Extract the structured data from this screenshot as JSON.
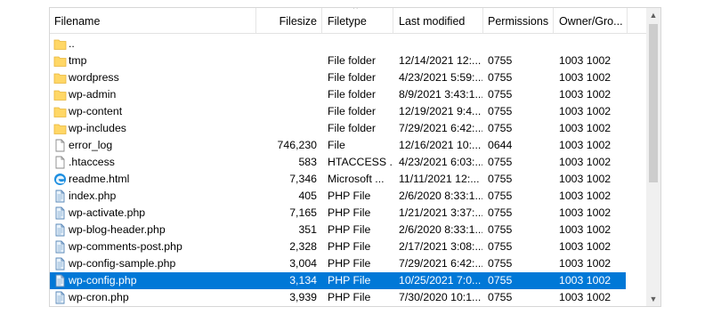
{
  "columns": {
    "filename": "Filename",
    "filesize": "Filesize",
    "filetype": "Filetype",
    "last_modified": "Last modified",
    "permissions": "Permissions",
    "owner": "Owner/Gro..."
  },
  "files": [
    {
      "name": "..",
      "size": "",
      "type": "",
      "modified": "",
      "perm": "",
      "owner": "",
      "icon": "folder-icon"
    },
    {
      "name": "tmp",
      "size": "",
      "type": "File folder",
      "modified": "12/14/2021 12:...",
      "perm": "0755",
      "owner": "1003 1002",
      "icon": "folder-icon"
    },
    {
      "name": "wordpress",
      "size": "",
      "type": "File folder",
      "modified": "4/23/2021 5:59:...",
      "perm": "0755",
      "owner": "1003 1002",
      "icon": "folder-icon"
    },
    {
      "name": "wp-admin",
      "size": "",
      "type": "File folder",
      "modified": "8/9/2021 3:43:1...",
      "perm": "0755",
      "owner": "1003 1002",
      "icon": "folder-icon"
    },
    {
      "name": "wp-content",
      "size": "",
      "type": "File folder",
      "modified": "12/19/2021 9:4...",
      "perm": "0755",
      "owner": "1003 1002",
      "icon": "folder-icon"
    },
    {
      "name": "wp-includes",
      "size": "",
      "type": "File folder",
      "modified": "7/29/2021 6:42:...",
      "perm": "0755",
      "owner": "1003 1002",
      "icon": "folder-icon"
    },
    {
      "name": "error_log",
      "size": "746,230",
      "type": "File",
      "modified": "12/16/2021 10:...",
      "perm": "0644",
      "owner": "1003 1002",
      "icon": "file-icon"
    },
    {
      "name": ".htaccess",
      "size": "583",
      "type": "HTACCESS ...",
      "modified": "4/23/2021 6:03:...",
      "perm": "0755",
      "owner": "1003 1002",
      "icon": "file-icon"
    },
    {
      "name": "readme.html",
      "size": "7,346",
      "type": "Microsoft ...",
      "modified": "11/11/2021 12:...",
      "perm": "0755",
      "owner": "1003 1002",
      "icon": "edge-icon"
    },
    {
      "name": "index.php",
      "size": "405",
      "type": "PHP File",
      "modified": "2/6/2020 8:33:1...",
      "perm": "0755",
      "owner": "1003 1002",
      "icon": "php-file-icon"
    },
    {
      "name": "wp-activate.php",
      "size": "7,165",
      "type": "PHP File",
      "modified": "1/21/2021 3:37:...",
      "perm": "0755",
      "owner": "1003 1002",
      "icon": "php-file-icon"
    },
    {
      "name": "wp-blog-header.php",
      "size": "351",
      "type": "PHP File",
      "modified": "2/6/2020 8:33:1...",
      "perm": "0755",
      "owner": "1003 1002",
      "icon": "php-file-icon"
    },
    {
      "name": "wp-comments-post.php",
      "size": "2,328",
      "type": "PHP File",
      "modified": "2/17/2021 3:08:...",
      "perm": "0755",
      "owner": "1003 1002",
      "icon": "php-file-icon"
    },
    {
      "name": "wp-config-sample.php",
      "size": "3,004",
      "type": "PHP File",
      "modified": "7/29/2021 6:42:...",
      "perm": "0755",
      "owner": "1003 1002",
      "icon": "php-file-icon"
    },
    {
      "name": "wp-config.php",
      "size": "3,134",
      "type": "PHP File",
      "modified": "10/25/2021 7:0...",
      "perm": "0755",
      "owner": "1003 1002",
      "icon": "php-file-icon",
      "selected": true
    },
    {
      "name": "wp-cron.php",
      "size": "3,939",
      "type": "PHP File",
      "modified": "7/30/2020 10:1...",
      "perm": "0755",
      "owner": "1003 1002",
      "icon": "php-file-icon"
    }
  ],
  "colors": {
    "selection": "#0078d7",
    "folder": "#ffd766",
    "folder_dark": "#e8b53a",
    "edge": "#1c8ee0"
  }
}
